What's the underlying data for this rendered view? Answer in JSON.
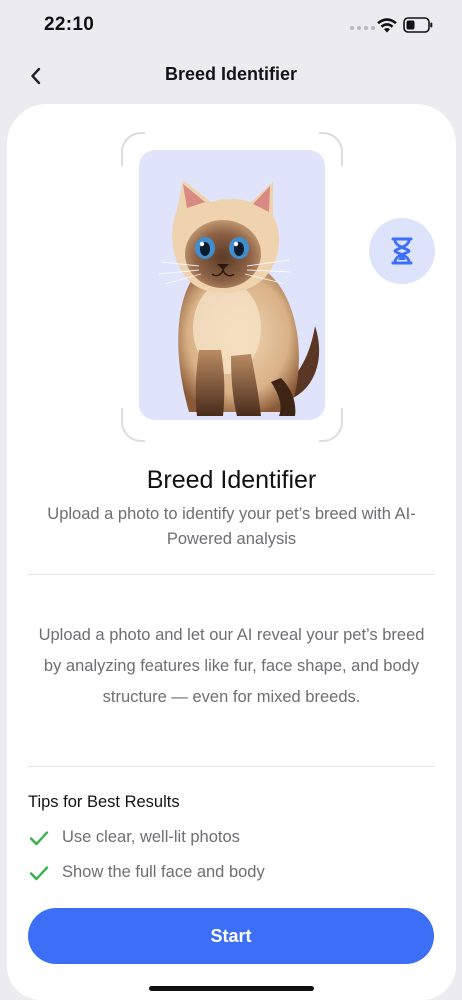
{
  "status_bar": {
    "time": "22:10"
  },
  "nav": {
    "title": "Breed Identifier",
    "back_icon": "chevron-left-icon"
  },
  "hero": {
    "photo_subject": "siamese-cat-illustration",
    "badge_icon": "hourglass-icon",
    "title": "Breed Identifier",
    "subtitle": "Upload a photo to identify your pet’s breed with AI-Powered analysis"
  },
  "description": "Upload a photo and let our AI reveal your pet’s breed by analyzing features like fur, face shape, and body structure — even for mixed breeds.",
  "tips": {
    "heading": "Tips for Best Results",
    "items": [
      {
        "label": "Use clear, well-lit photos",
        "icon": "check-icon"
      },
      {
        "label": "Show the full face and body",
        "icon": "check-icon"
      }
    ]
  },
  "actions": {
    "start_label": "Start"
  },
  "colors": {
    "accent": "#3d6ff6",
    "badge_bg": "#dde3fb",
    "photo_bg": "#dfe4fb",
    "check": "#34b24a",
    "muted_text": "#6e6e73"
  }
}
